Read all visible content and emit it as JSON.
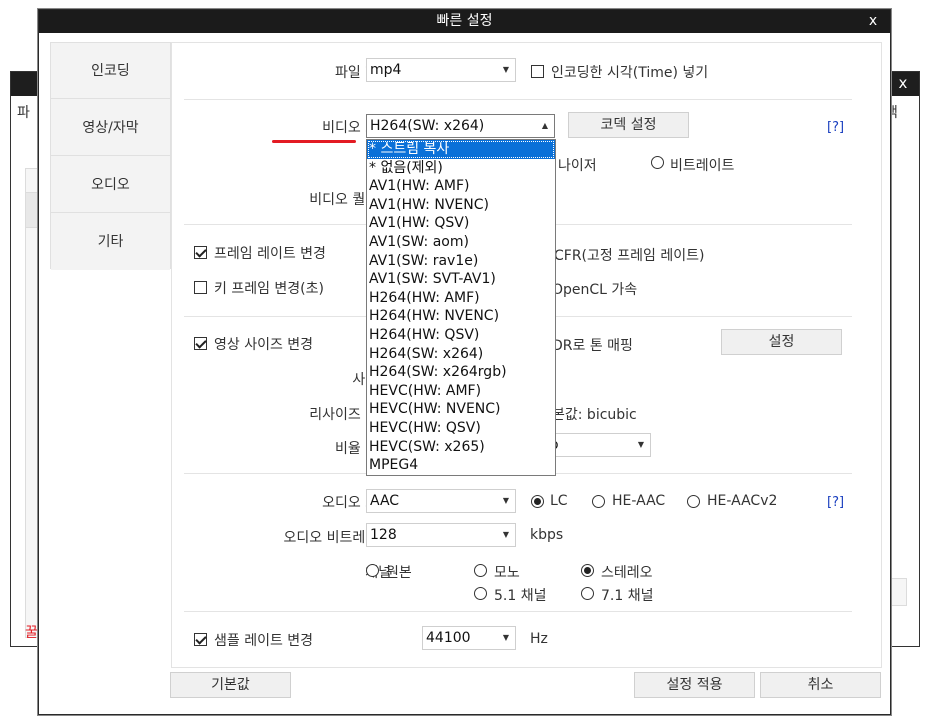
{
  "background_window": {
    "close": "x",
    "left_fragment_1": "파",
    "right_fragment_1": "백",
    "left_fragment_red": "꿀"
  },
  "dialog": {
    "title": "빠른 설정",
    "close": "x"
  },
  "sidebar": {
    "items": [
      {
        "label": "인코딩"
      },
      {
        "label": "영상/자막"
      },
      {
        "label": "오디오"
      },
      {
        "label": "기타"
      }
    ]
  },
  "file": {
    "format_label": "파일 형식",
    "format_value": "mp4",
    "timestamp_label": "인코딩한 시각(Time) 넣기",
    "timestamp_checked": false
  },
  "video": {
    "codec_label": "비디오 코덱",
    "codec_value": "H264(SW: x264)",
    "codec_settings_button": "코덱 설정",
    "help": "[?]",
    "quantizer_partial": "나이저",
    "bitrate_label": "비트레이트",
    "quality_label": "비디오 퀄리티",
    "codec_options": [
      "* 스트림 복사",
      "* 없음(제외)",
      "AV1(HW: AMF)",
      "AV1(HW: NVENC)",
      "AV1(HW: QSV)",
      "AV1(SW: aom)",
      "AV1(SW: rav1e)",
      "AV1(SW: SVT-AV1)",
      "H264(HW: AMF)",
      "H264(HW: NVENC)",
      "H264(HW: QSV)",
      "H264(SW: x264)",
      "H264(SW: x264rgb)",
      "HEVC(HW: AMF)",
      "HEVC(HW: NVENC)",
      "HEVC(HW: QSV)",
      "HEVC(SW: x265)",
      "MPEG4"
    ],
    "highlighted_option": "* 스트림 복사"
  },
  "frame": {
    "framerate_label": "프레임 레이트 변경",
    "framerate_checked": true,
    "cfr_label": "CFR(고정 프레임 레이트)",
    "keyframe_label": "키 프레임 변경(초)",
    "keyframe_checked": false,
    "opencl_label": "OpenCL 가속"
  },
  "resize": {
    "resize_label": "영상 사이즈 변경",
    "resize_checked": true,
    "tonemap_label": "DR로 톤 매핑",
    "tonemap_settings_button": "설정",
    "size_label": "사이즈",
    "filter_label": "리사이즈 필터",
    "filter_default_partial": "본값: bicubic",
    "ratio_label": "비율 변경",
    "ratio_partial": "o"
  },
  "audio": {
    "codec_label": "오디오 코덱",
    "codec_value": "AAC",
    "profiles": [
      {
        "label": "LC",
        "selected": true
      },
      {
        "label": "HE-AAC",
        "selected": false
      },
      {
        "label": "HE-AACv2",
        "selected": false
      }
    ],
    "help": "[?]",
    "bitrate_label": "오디오 비트레이트",
    "bitrate_value": "128",
    "bitrate_unit": "kbps",
    "channel_label": "채널",
    "channels": [
      {
        "label": "원본",
        "selected": false
      },
      {
        "label": "모노",
        "selected": false
      },
      {
        "label": "스테레오",
        "selected": true
      },
      {
        "label": "5.1 채널",
        "selected": false
      },
      {
        "label": "7.1 채널",
        "selected": false
      }
    ],
    "samplerate_label": "샘플 레이트 변경",
    "samplerate_checked": true,
    "samplerate_value": "44100",
    "samplerate_unit": "Hz"
  },
  "footer": {
    "default_button": "기본값",
    "apply_button": "설정 적용",
    "cancel_button": "취소"
  },
  "colors": {
    "titlebar": "#1b1b1b",
    "highlight": "#0a70d8",
    "annotation_red": "#e31b23",
    "help_link": "#1a3fbf"
  }
}
